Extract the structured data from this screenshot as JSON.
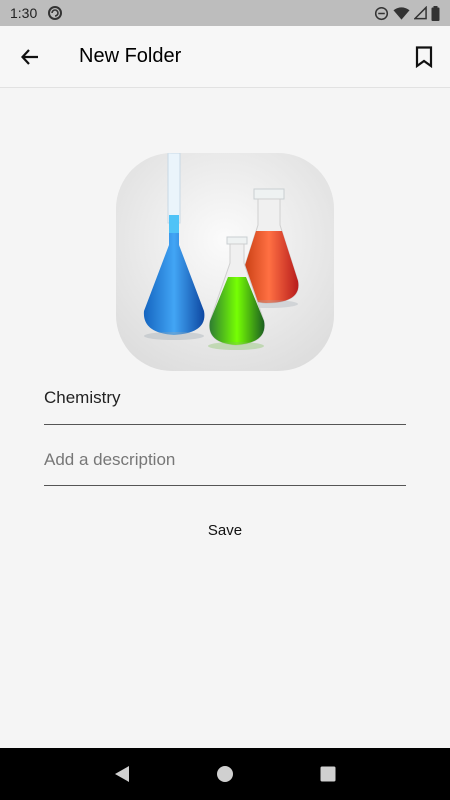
{
  "status_bar": {
    "time": "1:30",
    "icons": [
      "sync-icon",
      "do-not-disturb-icon",
      "wifi-icon",
      "cell-signal-icon",
      "battery-icon"
    ]
  },
  "app_bar": {
    "title": "New Folder",
    "back_icon": "arrow-back-icon",
    "bookmark_icon": "bookmark-icon"
  },
  "form": {
    "name_value": "Chemistry",
    "description_value": "",
    "description_placeholder": "Add a description",
    "save_label": "Save"
  },
  "nav_bar": {
    "icons": [
      "back-triangle-icon",
      "home-circle-icon",
      "recents-square-icon"
    ]
  },
  "colors": {
    "status_bar": "#bdbdbd",
    "background": "#f5f5f5",
    "nav_bar": "#000000",
    "flask_blue": "#1e88e5",
    "flask_green": "#43c22b",
    "flask_red": "#e64a19"
  }
}
